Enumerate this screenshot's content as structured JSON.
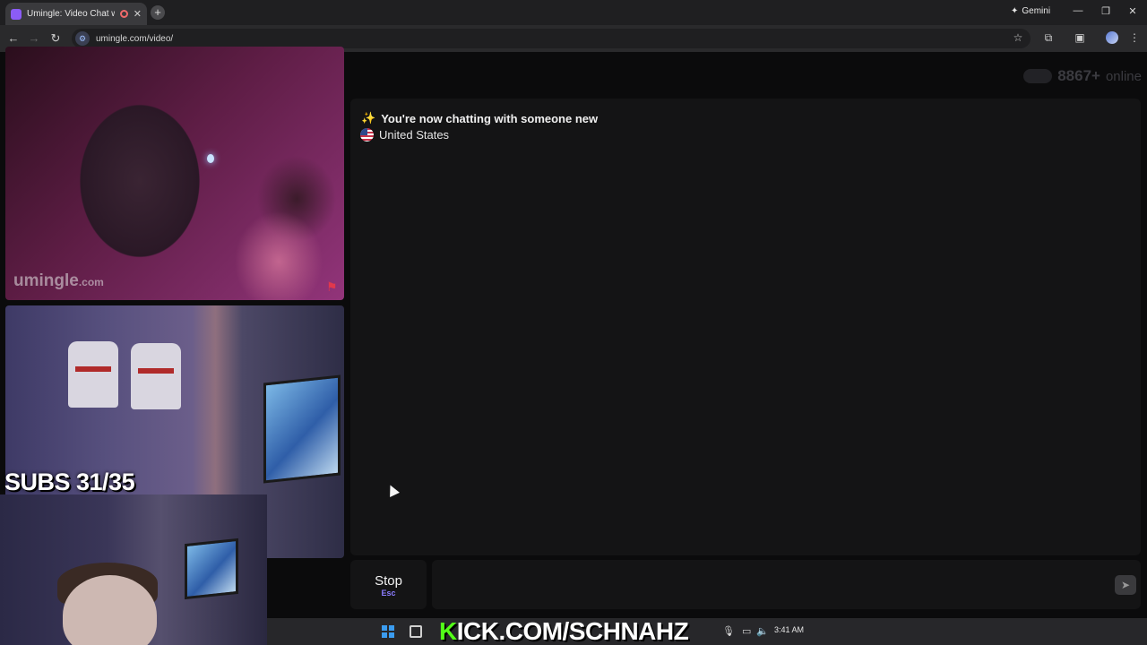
{
  "browser": {
    "tab_title": "Umingle: Video Chat with S",
    "new_tab_label": "+",
    "gemini_label": "Gemini",
    "url": "umingle.com/video/",
    "window_controls": {
      "minimize": "—",
      "restore": "❐",
      "close": "✕"
    }
  },
  "header": {
    "brand": "umingle",
    "online_count": "8867+",
    "online_label": "online"
  },
  "stranger_video": {
    "watermark_main": "umingle",
    "watermark_suffix": ".com"
  },
  "self_video": {
    "overlay_text": "SUBS 31/35"
  },
  "chat": {
    "system_icon": "✨",
    "system_message": "You're now chatting with someone new",
    "country": "United States"
  },
  "controls": {
    "stop_label": "Stop",
    "stop_shortcut": "Esc",
    "message_placeholder": "",
    "send_icon": "send-icon"
  },
  "taskbar": {
    "banner_prefix": "K",
    "banner_rest": "ICK.COM/SCHNAHZ",
    "time": "3:41 AM"
  },
  "colors": {
    "brand_purple": "#7c3aed",
    "kick_green": "#53fc18",
    "page_bg": "#0b0b0c",
    "panel_bg": "#141415"
  }
}
